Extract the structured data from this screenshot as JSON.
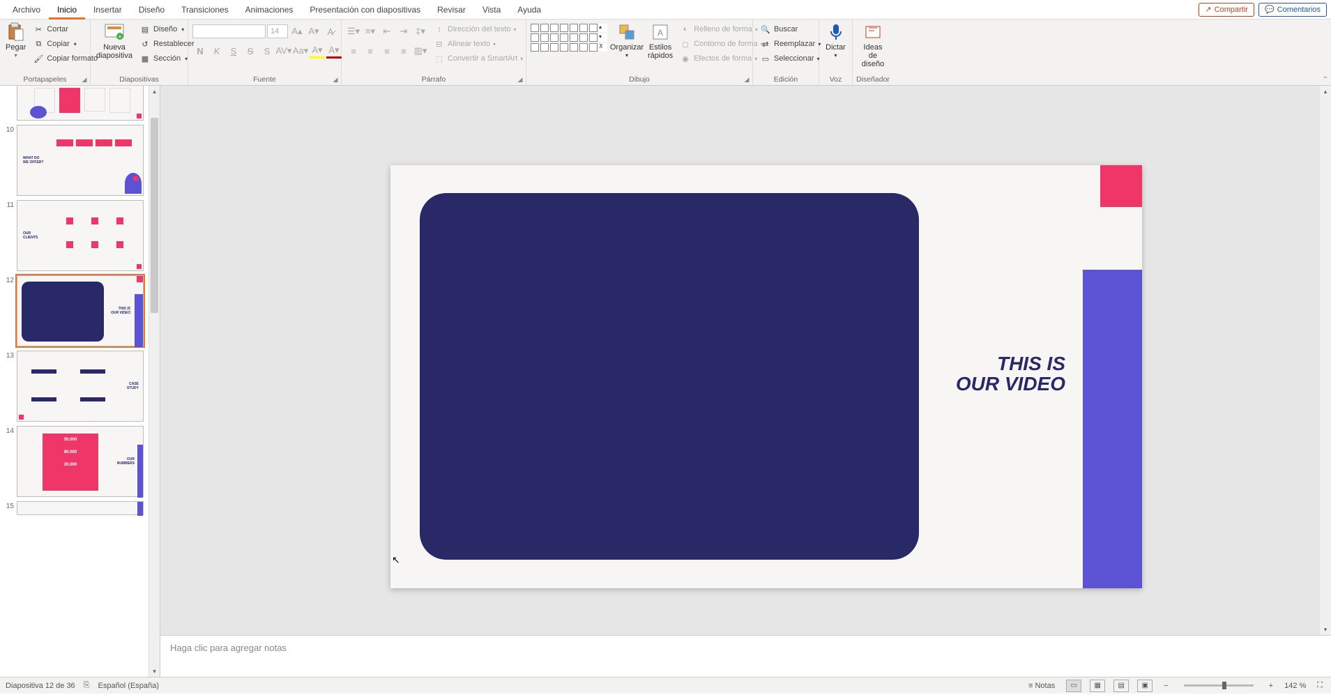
{
  "tabs": {
    "items": [
      "Archivo",
      "Inicio",
      "Insertar",
      "Diseño",
      "Transiciones",
      "Animaciones",
      "Presentación con diapositivas",
      "Revisar",
      "Vista",
      "Ayuda"
    ],
    "active": 1
  },
  "header": {
    "share": "Compartir",
    "comments": "Comentarios"
  },
  "ribbon": {
    "clipboard": {
      "label": "Portapapeles",
      "paste": "Pegar",
      "cut": "Cortar",
      "copy": "Copiar",
      "format_painter": "Copiar formato"
    },
    "slides": {
      "label": "Diapositivas",
      "new_slide": "Nueva\ndiapositiva",
      "layout": "Diseño",
      "reset": "Restablecer",
      "section": "Sección"
    },
    "font": {
      "label": "Fuente",
      "size": "14",
      "bold": "N",
      "italic": "K",
      "underline": "S",
      "strike": "S",
      "shadow": "S"
    },
    "paragraph": {
      "label": "Párrafo",
      "text_direction": "Dirección del texto",
      "align_text": "Alinear texto",
      "convert_smartart": "Convertir a SmartArt"
    },
    "drawing": {
      "label": "Dibujo",
      "arrange": "Organizar",
      "quick_styles": "Estilos\nrápidos",
      "shape_fill": "Relleno de forma",
      "shape_outline": "Contorno de forma",
      "shape_effects": "Efectos de forma"
    },
    "editing": {
      "label": "Edición",
      "find": "Buscar",
      "replace": "Reemplazar",
      "select": "Seleccionar"
    },
    "voice": {
      "label": "Voz",
      "dictate": "Dictar"
    },
    "designer": {
      "label": "Diseñador",
      "ideas": "Ideas de\ndiseño"
    }
  },
  "thumbnails": {
    "numbers": [
      "10",
      "11",
      "12",
      "13",
      "14",
      "15"
    ],
    "selected": "12"
  },
  "slide": {
    "title_line1": "THIS IS",
    "title_line2": "OUR VIDEO"
  },
  "notes": {
    "placeholder": "Haga clic para agregar notas"
  },
  "status": {
    "slide_info": "Diapositiva 12 de 36",
    "language": "Español (España)",
    "notes_btn": "Notas",
    "zoom": "142 %"
  },
  "thumbs_text": {
    "t10_title": "WHAT DO\nWE OFFER?",
    "t11_title": "OUR\nCLIENTS",
    "t12_line1": "THIS IS",
    "t12_line2": "OUR VIDEO",
    "t13_title": "CASE\nSTUDY",
    "t14_n1": "50,000",
    "t14_n2": "80,000",
    "t14_n3": "20,000",
    "t14_title": "OUR\nNUMBERS"
  }
}
